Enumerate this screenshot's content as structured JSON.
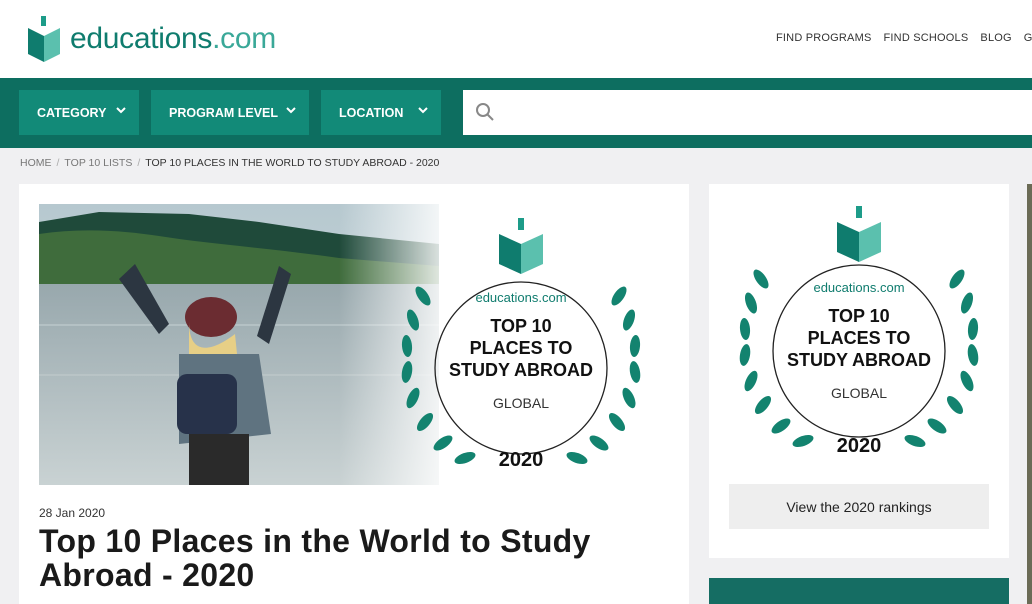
{
  "brand": {
    "name_main": "educations",
    "name_tld": ".com",
    "accent": "#0f7c6e",
    "dark_bar": "#0d6e60",
    "button_bg": "#128a78"
  },
  "topnav": [
    "FIND PROGRAMS",
    "FIND SCHOOLS",
    "BLOG",
    "GUI"
  ],
  "filters": {
    "category": "CATEGORY",
    "program_level": "PROGRAM LEVEL",
    "location": "LOCATION",
    "search_placeholder": ""
  },
  "breadcrumb": {
    "home": "HOME",
    "lists": "TOP 10 LISTS",
    "current": "TOP 10 PLACES IN THE WORLD TO STUDY ABROAD - 2020",
    "sep": "/"
  },
  "article": {
    "date": "28 Jan 2020",
    "title": "Top 10 Places in the World to Study Abroad - 2020"
  },
  "badge": {
    "brand": "educations.com",
    "line1": "TOP 10",
    "line2": "PLACES TO",
    "line3": "STUDY ABROAD",
    "scope": "GLOBAL",
    "year": "2020"
  },
  "side": {
    "button_label": "View the 2020 rankings"
  },
  "icons": {
    "logo": "book-logo-icon",
    "search": "search-icon",
    "chevron": "chevron-down-icon"
  }
}
